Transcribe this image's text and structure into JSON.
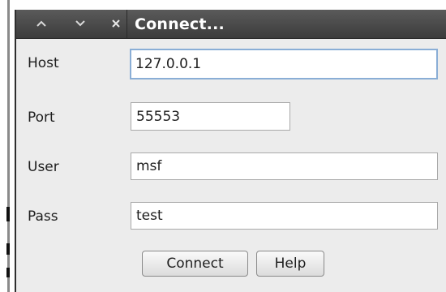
{
  "window": {
    "title": "Connect...",
    "controls": [
      {
        "name": "minimize-icon",
        "glyph": "^"
      },
      {
        "name": "maximize-icon",
        "glyph": "v"
      },
      {
        "name": "close-icon",
        "glyph": "×"
      }
    ]
  },
  "form": {
    "host_label": "Host",
    "host_value": "127.0.0.1",
    "port_label": "Port",
    "port_value": "55553",
    "user_label": "User",
    "user_value": "msf",
    "pass_label": "Pass",
    "pass_value": "test"
  },
  "buttons": {
    "connect_label": "Connect",
    "help_label": "Help"
  },
  "colors": {
    "titlebar": "#4a4a4a",
    "dialog_bg": "#ececec",
    "focus_border": "#8aaed6"
  }
}
